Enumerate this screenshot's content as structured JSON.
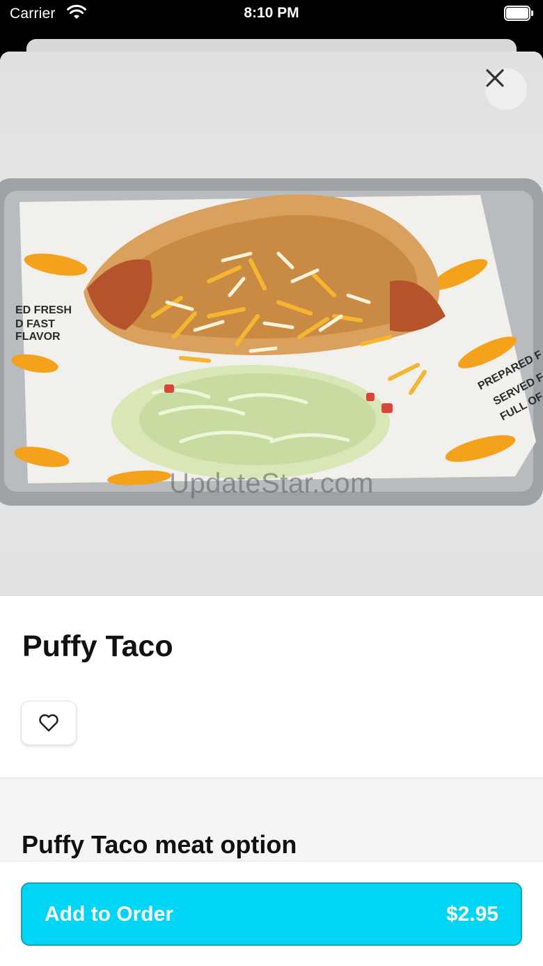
{
  "status_bar": {
    "carrier": "Carrier",
    "time": "8:10 PM"
  },
  "hero": {
    "watermark": "UpdateStar.com",
    "close_icon": "close-icon"
  },
  "item": {
    "name": "Puffy Taco",
    "favorite_icon": "heart-icon"
  },
  "options": {
    "section_title": "Puffy Taco meat option"
  },
  "cta": {
    "label": "Add to Order",
    "price": "$2.95",
    "color": "#00d5f5"
  }
}
